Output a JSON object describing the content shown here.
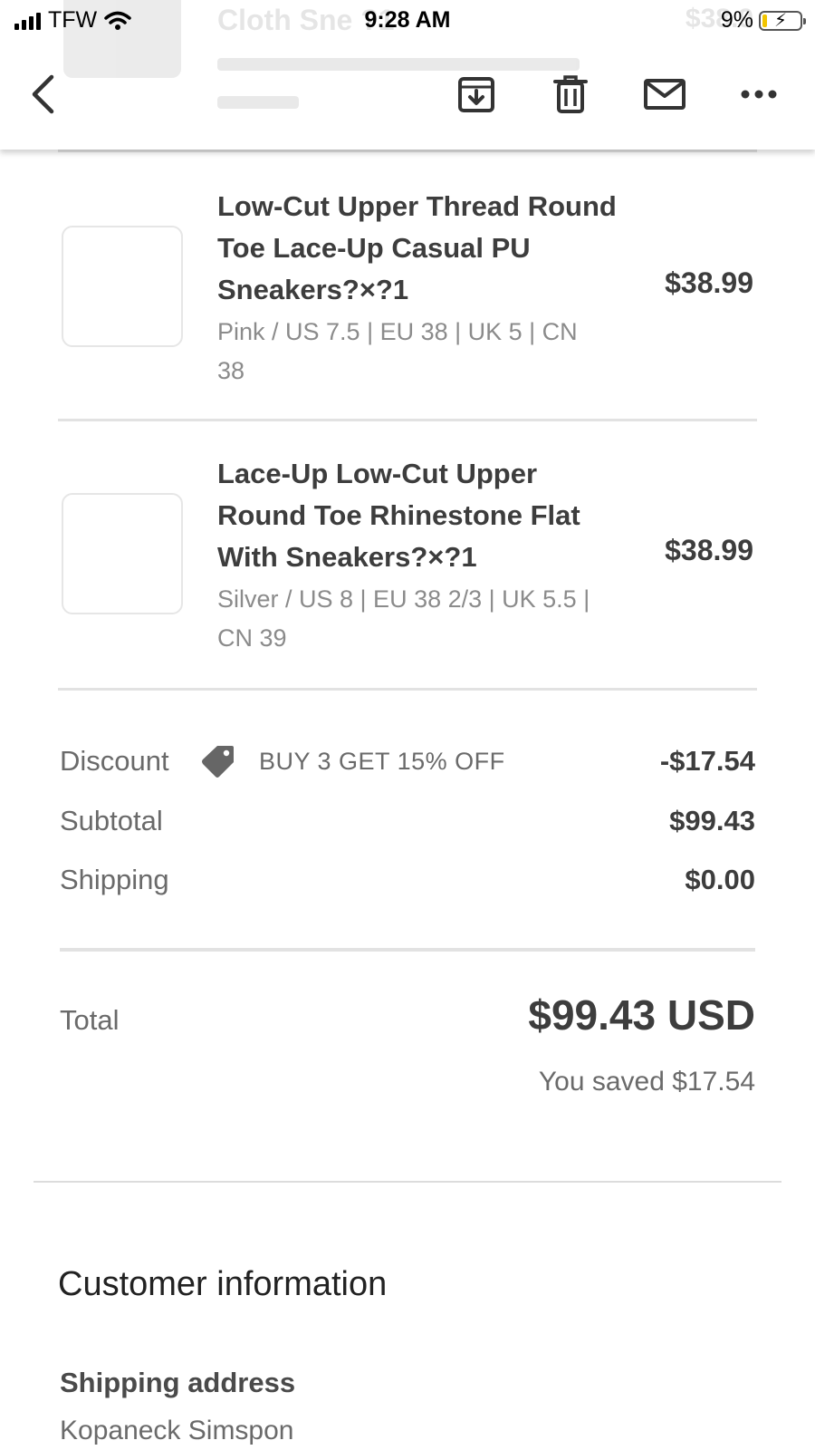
{
  "status_bar": {
    "carrier": "TFW",
    "time": "9:28 AM",
    "battery": "9%"
  },
  "toolbar": {
    "back_icon": "chevron-left-icon",
    "archive_icon": "archive-download-icon",
    "delete_icon": "trash-icon",
    "mail_icon": "envelope-icon",
    "more_icon": "more-horizontal-icon",
    "ghost_title": "Cloth Sne           ?1",
    "ghost_price": "$38.9"
  },
  "items": [
    {
      "title": "Low-Cut Upper Thread Round Toe Lace-Up Casual PU Sneakers?×?1",
      "variant": "Pink / US 7.5 | EU 38 | UK 5 | CN 38",
      "price": "$38.99"
    },
    {
      "title": "Lace-Up Low-Cut Upper Round Toe Rhinestone Flat With Sneakers?×?1",
      "variant": "Silver / US 8 | EU 38 2/3 | UK 5.5 | CN 39",
      "price": "$38.99"
    }
  ],
  "summary": {
    "discount_label": "Discount",
    "discount_code": "BUY 3 GET 15% OFF",
    "discount_value": "-$17.54",
    "subtotal_label": "Subtotal",
    "subtotal_value": "$99.43",
    "shipping_label": "Shipping",
    "shipping_value": "$0.00",
    "total_label": "Total",
    "total_value": "$99.43 USD",
    "saved_text": "You saved $17.54"
  },
  "customer": {
    "section_title": "Customer information",
    "shipping_address_label": "Shipping address",
    "name": "Kopaneck Simspon"
  },
  "colors": {
    "text_dark": "#3d3d3d",
    "text_muted": "#8b8b8b",
    "battery_low": "#f2c500"
  }
}
